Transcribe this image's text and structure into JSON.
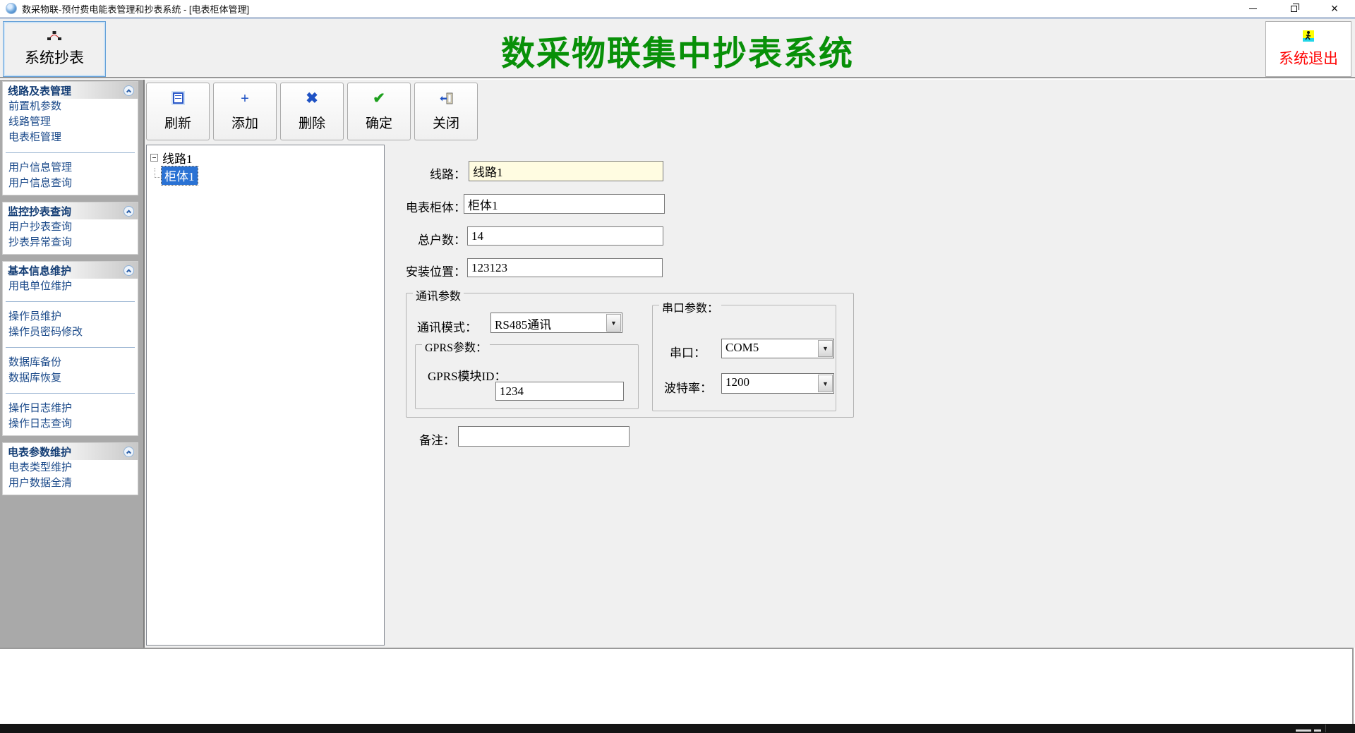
{
  "window": {
    "title": "数采物联-预付费电能表管理和抄表系统 - [电表柜体管理]"
  },
  "icons": {
    "close": "×",
    "dropdown_arrow": "▼",
    "add": "+",
    "delete": "✖",
    "confirm": "✔"
  },
  "banner": {
    "title": "数采物联集中抄表系统",
    "meter_button": "系统抄表",
    "exit_button": "系统退出"
  },
  "toolbar": {
    "buttons": [
      {
        "label": "刷新",
        "icon": "refresh-icon"
      },
      {
        "label": "添加",
        "icon": "add-icon"
      },
      {
        "label": "删除",
        "icon": "delete-icon"
      },
      {
        "label": "确定",
        "icon": "confirm-icon"
      },
      {
        "label": "关闭",
        "icon": "exit-door-icon"
      }
    ]
  },
  "sidebar": {
    "items": [
      "线路及表管理",
      "前置机参数",
      "线路管理",
      "电表柜管理",
      "用户信息管理",
      "用户信息查询",
      "监控抄表查询",
      "用户抄表查询",
      "抄表异常查询",
      "基本信息维护",
      "用电单位维护",
      "操作员维护",
      "操作员密码修改",
      "数据库备份",
      "数据库恢复",
      "操作日志维护",
      "操作日志查询",
      "电表参数维护",
      "电表类型维护",
      "用户数据全清"
    ]
  },
  "tree": {
    "root": "线路1",
    "child": "柜体1"
  },
  "form": {
    "line_label": "线路：",
    "line_value": "线路1",
    "cabinet_label": "电表柜体：",
    "cabinet_value": "柜体1",
    "households_label": "总户数：",
    "households_value": "14",
    "location_label": "安装位置：",
    "location_value": "123123",
    "comm_group_title": "通讯参数",
    "comm_mode_label": "通讯模式：",
    "comm_mode_value": "RS485通讯",
    "gprs_group_title": "GPRS参数：",
    "gprs_id_label": "GPRS模块ID：",
    "gprs_id_value": "1234",
    "serial_group_title": "串口参数：",
    "serial_port_label": "串口：",
    "serial_port_value": "COM5",
    "baud_label": "波特率：",
    "baud_value": "1200",
    "remark_label": "备注：",
    "remark_value": ""
  },
  "colors": {
    "banner_title": "#089008",
    "exit_text": "#ff0000",
    "tree_selection": "#2a72d4",
    "readonly_field_bg": "#fffce1",
    "sidebar_item_text": "#1b4a8a"
  }
}
